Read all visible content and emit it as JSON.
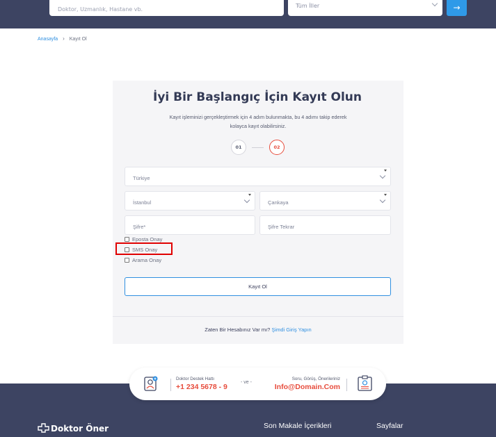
{
  "header": {
    "search_placeholder": "Doktor, Uzmanlık, Hastane vb.",
    "city_value": "Tüm İller",
    "go_glyph": "→"
  },
  "breadcrumb": {
    "home": "Anasayfa",
    "current": "Kayıt Ol"
  },
  "form": {
    "title": "İyi Bir Başlangıç İçin Kayıt Olun",
    "description": "Kayıt işleminizi gerçekleştirmek için 4 adım bulunmakta, bu 4 adımı takip ederek kolayca kayıt olabilirsiniz.",
    "steps": [
      "01",
      "02"
    ],
    "country": "Türkiye",
    "city": "İstanbul",
    "district": "Çankaya",
    "password_placeholder": "Şifre*",
    "password_repeat_placeholder": "Şifre Tekrar",
    "checkboxes": [
      "Eposta Onay",
      "SMS Onay",
      "Arama Onay"
    ],
    "submit_label": "Kayıt Ol",
    "login_prompt": "Zaten Bir Hesabınız Var mı?",
    "login_link": "Şimdi Giriş Yapın"
  },
  "contact": {
    "support_label": "Doktor Destek Hattı",
    "support_phone": "+1 234 5678 - 9",
    "and": "- ve -",
    "opinion_label": "Soru, Görüş, Önerileriniz",
    "opinion_email": "Info@Domain.Com"
  },
  "footer": {
    "logo_text": "Doktor Öner",
    "col1_title": "Son Makale İçerikleri",
    "col2_title": "Sayfalar"
  },
  "colors": {
    "navy": "#3d4462",
    "accent_blue": "#2f8fe0",
    "accent_red": "#e74c3c",
    "highlight": "#e00000"
  }
}
